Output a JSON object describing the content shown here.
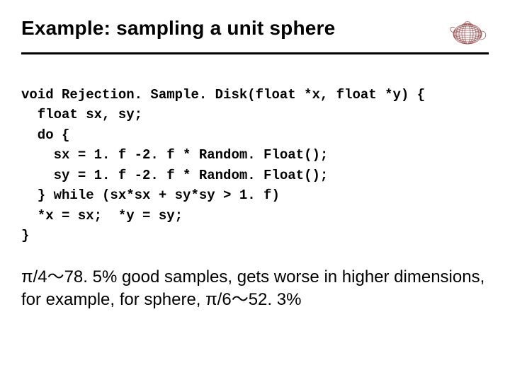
{
  "title": "Example: sampling a unit sphere",
  "code": {
    "l1": "void Rejection. Sample. Disk(float *x, float *y) {",
    "l2": "  float sx, sy;",
    "l3": "  do {",
    "l4": "    sx = 1. f -2. f * Random. Float();",
    "l5": "    sy = 1. f -2. f * Random. Float();",
    "l6": "  } while (sx*sx + sy*sy > 1. f)",
    "l7": "  *x = sx;  *y = sy;",
    "l8": "}"
  },
  "body": "π/4～78. 5% good samples, gets worse in higher dimensions, for example, for sphere, π/6～52. 3%"
}
